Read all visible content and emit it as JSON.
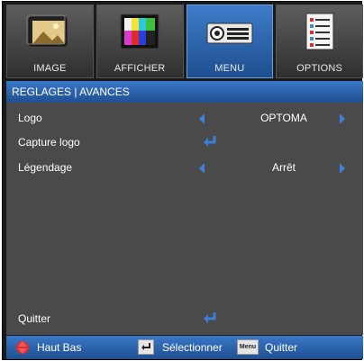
{
  "tabs": [
    {
      "label": "IMAGE",
      "icon": "image-icon"
    },
    {
      "label": "AFFICHER",
      "icon": "display-icon"
    },
    {
      "label": "MENU",
      "icon": "projector-menu-icon"
    },
    {
      "label": "OPTIONS",
      "icon": "options-icon"
    }
  ],
  "section_title": "REGLAGES | AVANCES",
  "settings": [
    {
      "label": "Logo",
      "value": "OPTOMA"
    },
    {
      "label": "Capture logo"
    },
    {
      "label": "Légendage",
      "value": "Arrêt"
    }
  ],
  "quit_label": "Quitter",
  "footer": {
    "nav_label": "Haut Bas",
    "select_label": "Sélectionner",
    "menu_key": "Menu",
    "quit_label": "Quitter"
  },
  "colors": {
    "accent": "#2b63b0",
    "arrow": "#3e7fd8",
    "panel": "#4a4a4a"
  }
}
